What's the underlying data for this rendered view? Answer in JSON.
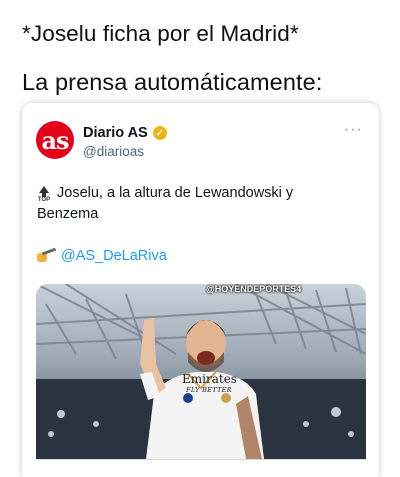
{
  "captions": {
    "line1": "*Joselu ficha por el Madrid*",
    "line2": "La prensa automáticamente:"
  },
  "tweet": {
    "avatar_text": "as",
    "display_name": "Diario AS",
    "handle": "@diarioas",
    "more_icon": "more-icon",
    "top_badge": "TOP",
    "text_line1": "Joselu, a la altura de Lewandowski y",
    "text_line2": "Benzema",
    "mention": "@AS_DeLaRiva",
    "image": {
      "watermark": "@HOYENDEPORTES4",
      "shirt_sponsor": "Emirates",
      "shirt_sponsor_sub": "FLY BETTER"
    }
  },
  "colors": {
    "brand_red": "#e2001a",
    "verified_gold": "#e8b416",
    "mention_blue": "#1d9bf0"
  }
}
